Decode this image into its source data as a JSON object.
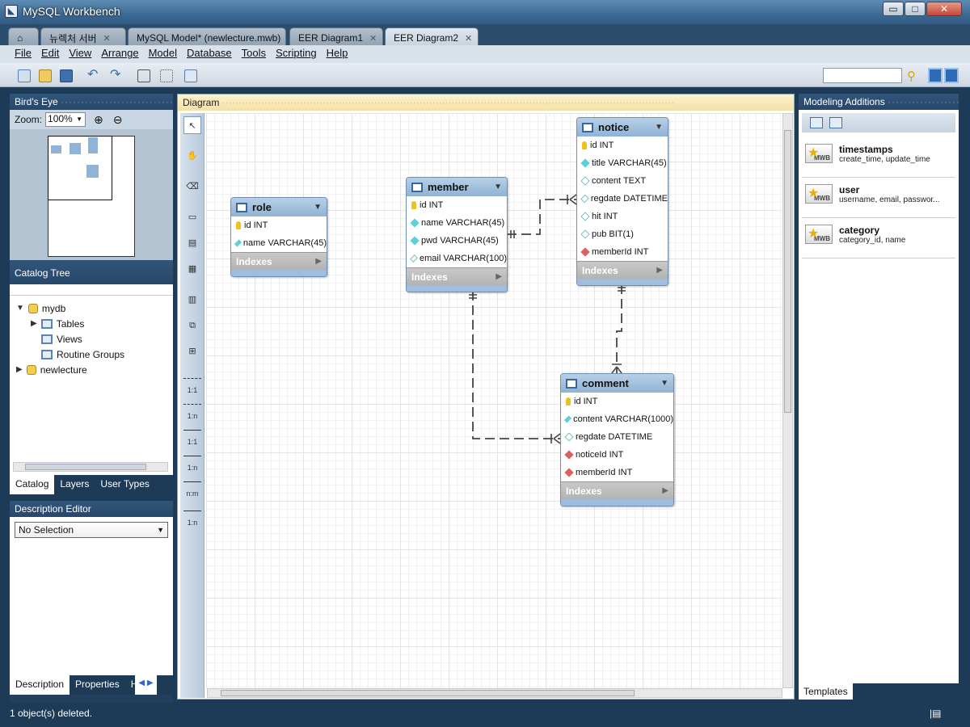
{
  "window": {
    "title": "MySQL Workbench",
    "minimize": "▭",
    "maximize": "□",
    "close": "✕"
  },
  "tabs": [
    {
      "label": "⌂"
    },
    {
      "label": "뉴렉처 서버",
      "close": "✕"
    },
    {
      "label": "MySQL Model* (newlecture.mwb)",
      "close": "✕"
    },
    {
      "label": "EER Diagram1",
      "close": "✕"
    },
    {
      "label": "EER Diagram2",
      "close": "✕"
    }
  ],
  "menu": [
    "File",
    "Edit",
    "View",
    "Arrange",
    "Model",
    "Database",
    "Tools",
    "Scripting",
    "Help"
  ],
  "birds_eye": {
    "title": "Bird's Eye",
    "zoom_label": "Zoom:",
    "zoom_value": "100%"
  },
  "catalog_tree": {
    "title": "Catalog Tree",
    "items": [
      {
        "label": "mydb",
        "expander": "▼"
      },
      {
        "label": "Tables",
        "expander": "▶"
      },
      {
        "label": "Views"
      },
      {
        "label": "Routine Groups"
      },
      {
        "label": "newlecture",
        "expander": "▶"
      }
    ],
    "tabs": [
      "Catalog",
      "Layers",
      "User Types"
    ]
  },
  "description_editor": {
    "title": "Description Editor",
    "selection": "No Selection",
    "tabs": [
      "Description",
      "Properties",
      "H"
    ]
  },
  "diagram": {
    "title": "Diagram",
    "tools": [
      "↖",
      "✋",
      "⌫",
      "▭",
      "▤",
      "▦",
      "▥",
      "⧉",
      "⊞",
      "1:1",
      "1:n",
      "1:1",
      "1:n",
      "n:m",
      "1:n"
    ],
    "tables": [
      {
        "name": "role",
        "columns": [
          {
            "text": "id INT",
            "key": "pk"
          },
          {
            "text": "name VARCHAR(45)",
            "key": "nn"
          }
        ],
        "indexes": "Indexes"
      },
      {
        "name": "member",
        "columns": [
          {
            "text": "id INT",
            "key": "pk"
          },
          {
            "text": "name VARCHAR(45)",
            "key": "nn"
          },
          {
            "text": "pwd VARCHAR(45)",
            "key": "nn"
          },
          {
            "text": "email VARCHAR(100)",
            "key": "nul"
          }
        ],
        "indexes": "Indexes"
      },
      {
        "name": "notice",
        "columns": [
          {
            "text": "id INT",
            "key": "pk"
          },
          {
            "text": "title VARCHAR(45)",
            "key": "nn"
          },
          {
            "text": "content TEXT",
            "key": "nul"
          },
          {
            "text": "regdate DATETIME",
            "key": "nul"
          },
          {
            "text": "hit INT",
            "key": "nul"
          },
          {
            "text": "pub BIT(1)",
            "key": "nul"
          },
          {
            "text": "memberId INT",
            "key": "fk"
          }
        ],
        "indexes": "Indexes"
      },
      {
        "name": "comment",
        "columns": [
          {
            "text": "id INT",
            "key": "pk"
          },
          {
            "text": "content VARCHAR(1000)",
            "key": "nn"
          },
          {
            "text": "regdate DATETIME",
            "key": "nul"
          },
          {
            "text": "noticeId INT",
            "key": "fk"
          },
          {
            "text": "memberId INT",
            "key": "fk"
          }
        ],
        "indexes": "Indexes"
      }
    ]
  },
  "modeling_additions": {
    "title": "Modeling Additions",
    "templates": [
      {
        "name": "timestamps",
        "desc": "create_time, update_time",
        "badge": "MWB"
      },
      {
        "name": "user",
        "desc": "username, email, passwor...",
        "badge": "MWB"
      },
      {
        "name": "category",
        "desc": "category_id, name",
        "badge": "MWB"
      }
    ],
    "tab": "Templates"
  },
  "status": {
    "message": "1 object(s) deleted.",
    "right_icon": "|▤"
  },
  "colors": {
    "chrome": "#1d3b57",
    "table_header": "#9fbede",
    "diagram_header": "#f4e1a5"
  }
}
